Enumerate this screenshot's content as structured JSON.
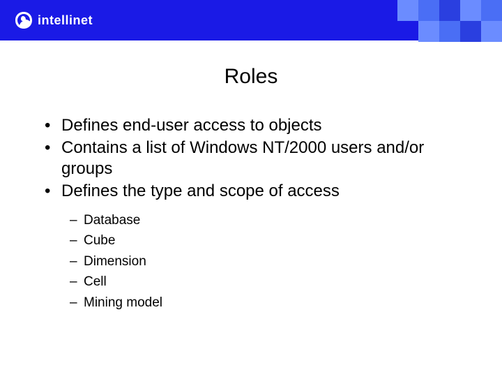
{
  "brand": {
    "name": "intellinet"
  },
  "slide": {
    "title": "Roles",
    "bullets": [
      {
        "text": "Defines end-user access to objects"
      },
      {
        "text": "Contains a list of Windows NT/2000 users and/or groups"
      },
      {
        "text": "Defines the type and scope of access"
      }
    ],
    "sub_bullets": [
      {
        "text": "Database"
      },
      {
        "text": "Cube"
      },
      {
        "text": "Dimension"
      },
      {
        "text": "Cell"
      },
      {
        "text": "Mining model"
      }
    ]
  },
  "colors": {
    "header": "#1a1ae6",
    "sq_light": "#6b8cff",
    "sq_mid": "#4a6ef5",
    "sq_dark": "#2a3fe0"
  }
}
